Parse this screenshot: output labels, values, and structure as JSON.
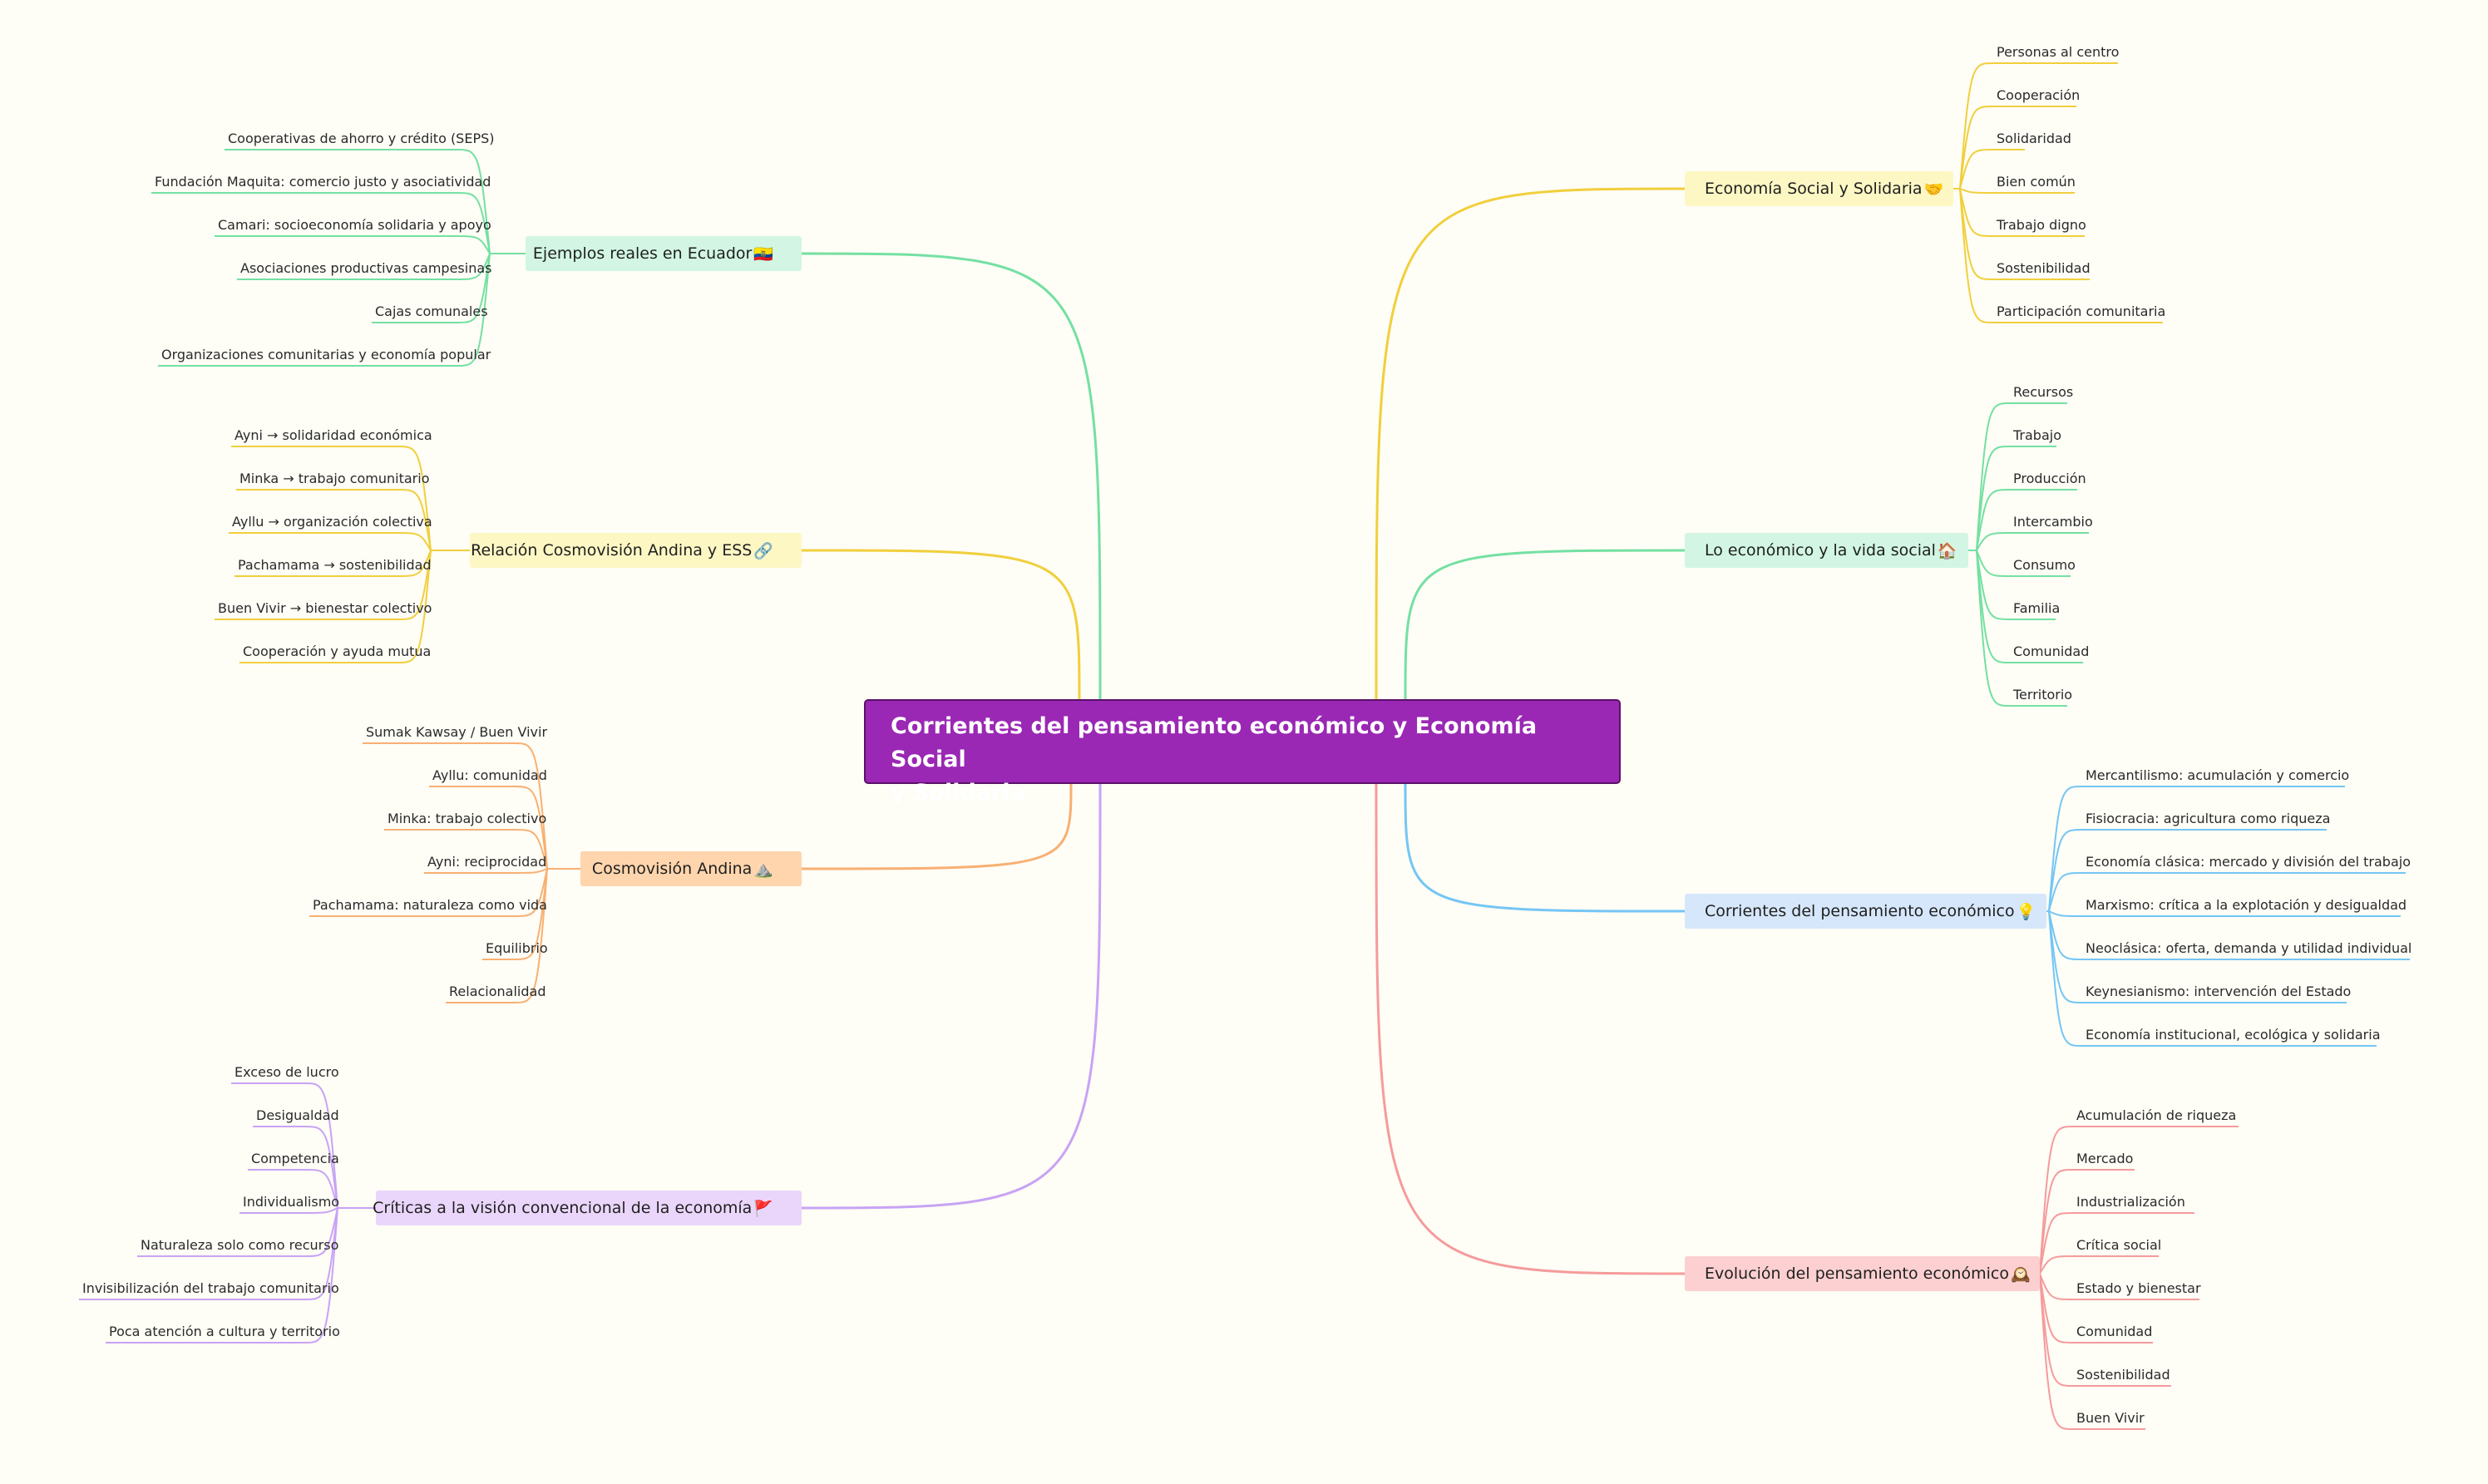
{
  "root": {
    "line1": "Corrientes del pensamiento económico y Economía Social",
    "line2": "y Solidaria"
  },
  "branches": [
    {
      "side": "left",
      "label": "Ejemplos reales en Ecuador",
      "emoji": "🇪🇨",
      "icon": "ecuador-flag-icon",
      "fill": "#d2f6e3",
      "line": "#74e0a2",
      "children": [
        "Cooperativas de ahorro y crédito (SEPS)",
        "Fundación Maquita: comercio justo y asociatividad",
        "Camari: socioeconomía solidaria y apoyo",
        "Asociaciones productivas campesinas",
        "Cajas comunales",
        "Organizaciones comunitarias y economía popular"
      ]
    },
    {
      "side": "left",
      "label": "Relación Cosmovisión Andina y ESS",
      "emoji": "🔗",
      "icon": "link-icon",
      "fill": "#fdf7c4",
      "line": "#f1cf3c",
      "children": [
        "Ayni → solidaridad económica",
        "Minka → trabajo comunitario",
        "Ayllu → organización colectiva",
        "Pachamama → sostenibilidad",
        "Buen Vivir → bienestar colectivo",
        "Cooperación y ayuda mutua"
      ]
    },
    {
      "side": "left",
      "label": "Cosmovisión Andina",
      "emoji": "⛰️",
      "icon": "mountain-icon",
      "fill": "#fed5ad",
      "line": "#f8b072",
      "children": [
        "Sumak Kawsay / Buen Vivir",
        "Ayllu: comunidad",
        "Minka: trabajo colectivo",
        "Ayni: reciprocidad",
        "Pachamama: naturaleza como vida",
        "Equilibrio",
        "Relacionalidad"
      ]
    },
    {
      "side": "left",
      "label": "Críticas a la visión convencional de la economía",
      "emoji": "🚩",
      "icon": "red-flag-icon",
      "fill": "#ead6fb",
      "line": "#c8a3f5",
      "children": [
        "Exceso de lucro",
        "Desigualdad",
        "Competencia",
        "Individualismo",
        "Naturaleza solo como recurso",
        "Invisibilización del trabajo comunitario",
        "Poca atención a cultura y territorio"
      ]
    },
    {
      "side": "right",
      "label": "Economía Social y Solidaria",
      "emoji": "🤝",
      "icon": "handshake-icon",
      "fill": "#fdf7c4",
      "line": "#f1cf3c",
      "children": [
        "Personas al centro",
        "Cooperación",
        "Solidaridad",
        "Bien común",
        "Trabajo digno",
        "Sostenibilidad",
        "Participación comunitaria"
      ]
    },
    {
      "side": "right",
      "label": "Lo económico y la vida social",
      "emoji": "🏠",
      "icon": "house-icon",
      "fill": "#d2f6e3",
      "line": "#74e0a2",
      "children": [
        "Recursos",
        "Trabajo",
        "Producción",
        "Intercambio",
        "Consumo",
        "Familia",
        "Comunidad",
        "Territorio"
      ]
    },
    {
      "side": "right",
      "label": "Corrientes del pensamiento económico",
      "emoji": "💡",
      "icon": "lightbulb-icon",
      "fill": "#d6e7fb",
      "line": "#74c6f4",
      "children": [
        "Mercantilismo: acumulación y comercio",
        "Fisiocracia: agricultura como riqueza",
        "Economía clásica: mercado y división del trabajo",
        "Marxismo: crítica a la explotación y desigualdad",
        "Neoclásica: oferta, demanda y utilidad individual",
        "Keynesianismo: intervención del Estado",
        "Economía institucional, ecológica y solidaria"
      ]
    },
    {
      "side": "right",
      "label": "Evolución del pensamiento económico",
      "emoji": "🕰️",
      "icon": "clock-icon",
      "fill": "#fcd0d0",
      "line": "#f59b9b",
      "children": [
        "Acumulación de riqueza",
        "Mercado",
        "Industrialización",
        "Crítica social",
        "Estado y bienestar",
        "Comunidad",
        "Sostenibilidad",
        "Buen Vivir"
      ]
    }
  ]
}
